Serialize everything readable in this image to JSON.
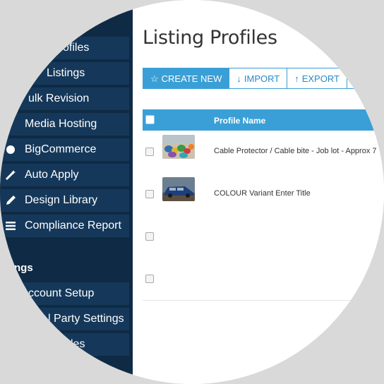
{
  "sidebar": {
    "items": [
      {
        "label": "ofiles",
        "icon": ""
      },
      {
        "label": "Listings",
        "icon": ""
      },
      {
        "label": "ulk Revision",
        "icon": ""
      },
      {
        "label": "Media Hosting",
        "icon": ""
      },
      {
        "label": "BigCommerce",
        "icon": ""
      },
      {
        "label": "Auto Apply",
        "icon": "wand-icon"
      },
      {
        "label": "Design Library",
        "icon": "pencil-icon"
      },
      {
        "label": "Compliance Report",
        "icon": "list-icon"
      }
    ],
    "section_heading": "ngs",
    "section_items": [
      {
        "label": "ccount Setup"
      },
      {
        "label": "l Party Settings"
      },
      {
        "label": "les"
      }
    ]
  },
  "main": {
    "title": "Listing Profiles",
    "toolbar": {
      "create_new": "CREATE NEW",
      "import": "IMPORT",
      "export": "EXPORT"
    },
    "table": {
      "column_profile_name": "Profile Name",
      "rows": [
        {
          "name": "Cable Protector / Cable bite - Job lot - Approx 7",
          "thumb": "cable-protectors"
        },
        {
          "name": "COLOUR Variant Enter Title",
          "thumb": "car-photo"
        },
        {
          "name": "",
          "thumb": ""
        },
        {
          "name": "",
          "thumb": ""
        }
      ]
    }
  },
  "colors": {
    "sidebar_bg": "#0f2a44",
    "sidebar_item_bg": "#15385a",
    "accent": "#3a9fd6",
    "page_bg": "#d9d9d9"
  }
}
